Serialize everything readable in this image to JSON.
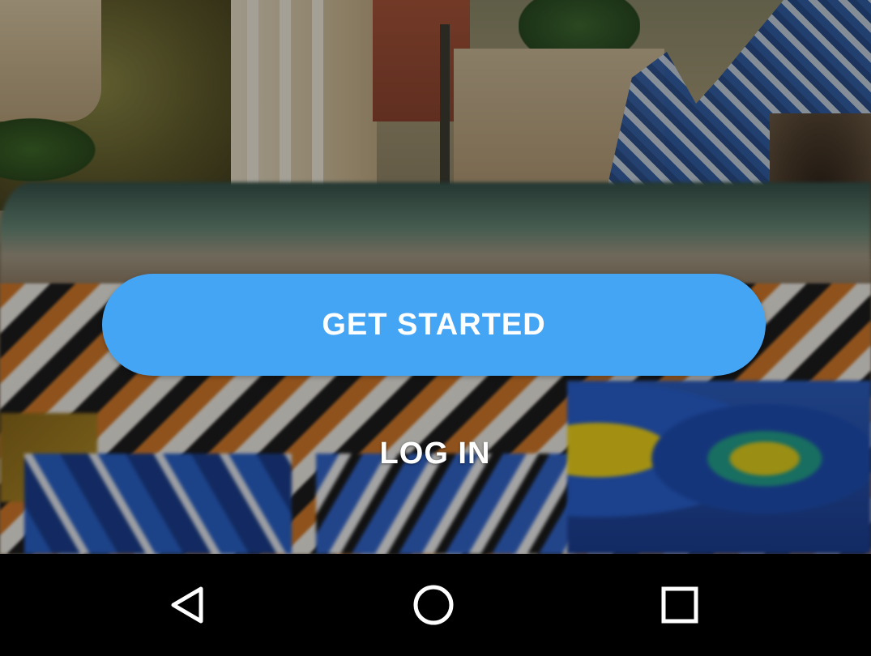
{
  "buttons": {
    "get_started": "GET STARTED",
    "log_in": "LOG IN"
  },
  "navigation_bar": {
    "back_icon": "triangle-back-icon",
    "home_icon": "circle-home-icon",
    "recents_icon": "square-recents-icon"
  },
  "colors": {
    "primary_button": "#45a5f5",
    "button_text": "#ffffff",
    "nav_bar_background": "#000000",
    "nav_icon": "#ffffff"
  }
}
